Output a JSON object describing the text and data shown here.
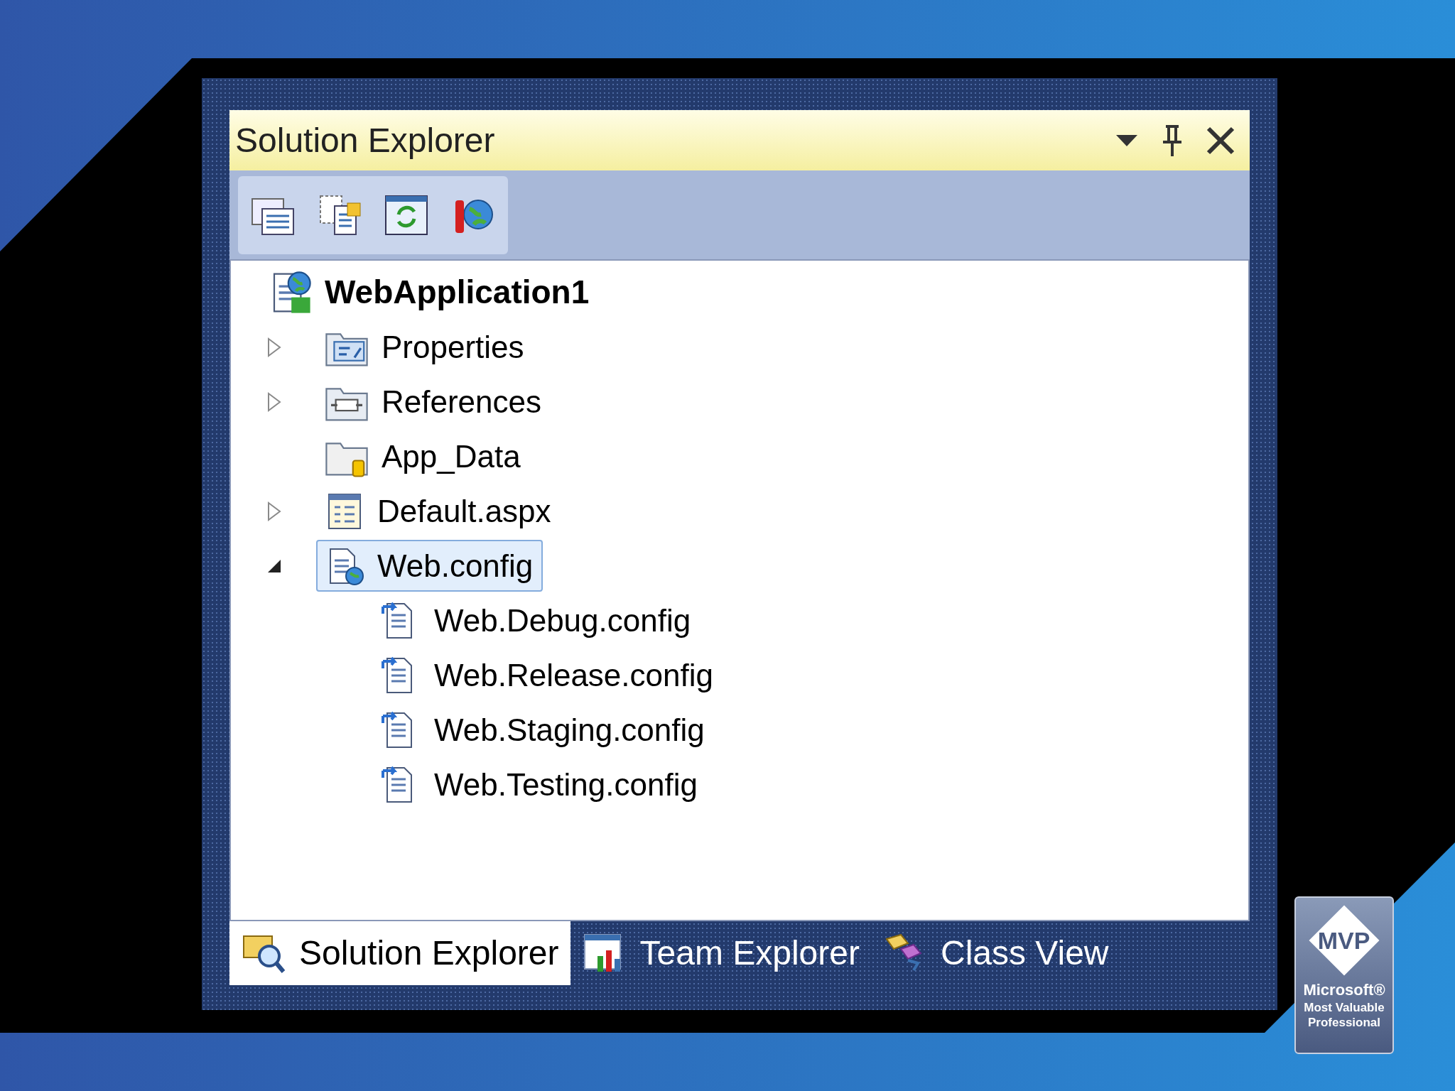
{
  "panel": {
    "title": "Solution Explorer"
  },
  "toolbar": {
    "buttons": [
      {
        "kind": "properties"
      },
      {
        "kind": "show-all"
      },
      {
        "kind": "refresh"
      },
      {
        "kind": "web-config"
      }
    ]
  },
  "tree": {
    "label": "WebApplication1",
    "kind": "project",
    "selected": false,
    "children": [
      {
        "label": "Properties",
        "kind": "properties",
        "expanded": false,
        "selected": false
      },
      {
        "label": "References",
        "kind": "references",
        "expanded": false,
        "selected": false
      },
      {
        "label": "App_Data",
        "kind": "folder",
        "selected": false
      },
      {
        "label": "Default.aspx",
        "kind": "page",
        "expanded": false,
        "selected": false
      },
      {
        "label": "Web.config",
        "kind": "config",
        "expanded": true,
        "selected": true,
        "children": [
          {
            "label": "Web.Debug.config",
            "kind": "transform",
            "selected": false
          },
          {
            "label": "Web.Release.config",
            "kind": "transform",
            "selected": false
          },
          {
            "label": "Web.Staging.config",
            "kind": "transform",
            "selected": false
          },
          {
            "label": "Web.Testing.config",
            "kind": "transform",
            "selected": false
          }
        ]
      }
    ]
  },
  "tabs": [
    {
      "label": "Solution Explorer",
      "kind": "solution",
      "selected": true
    },
    {
      "label": "Team Explorer",
      "kind": "team",
      "selected": false
    },
    {
      "label": "Class View",
      "kind": "class",
      "selected": false
    }
  ],
  "badge": {
    "title": "MVP",
    "lines": [
      "Microsoft®",
      "Most Valuable",
      "Professional"
    ]
  }
}
